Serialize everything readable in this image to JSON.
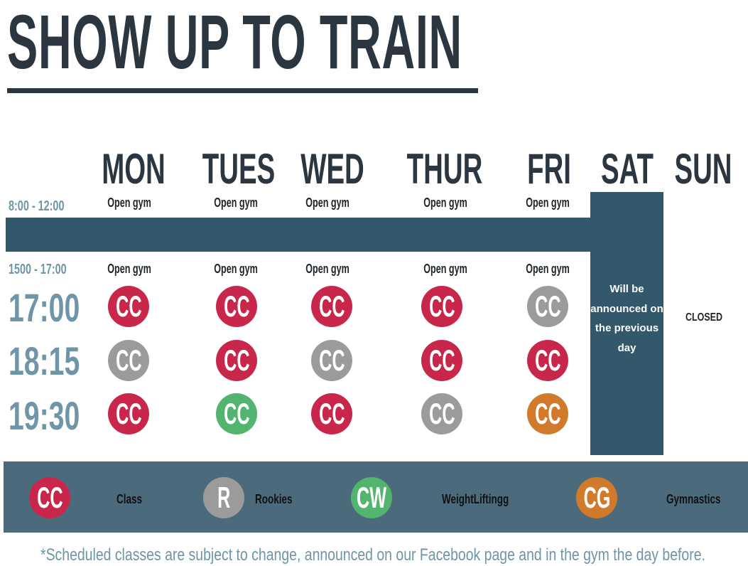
{
  "title": "SHOW UP TO TRAIN",
  "days": [
    "MON",
    "TUES",
    "WED",
    "THUR",
    "FRI",
    "SAT",
    "SUN"
  ],
  "slots": {
    "morning": "8:00 - 12:00",
    "afternoon": "1500 - 17:00",
    "open_gym_label": "Open gym"
  },
  "times": [
    "17:00",
    "18:15",
    "19:30"
  ],
  "schedule": [
    [
      {
        "code": "CC",
        "color": "#c8274b"
      },
      {
        "code": "CC",
        "color": "#c8274b"
      },
      {
        "code": "CC",
        "color": "#c8274b"
      },
      {
        "code": "CC",
        "color": "#c8274b"
      },
      {
        "code": "CC",
        "color": "#9b9b9b"
      }
    ],
    [
      {
        "code": "CC",
        "color": "#9b9b9b"
      },
      {
        "code": "CC",
        "color": "#c8274b"
      },
      {
        "code": "CC",
        "color": "#9b9b9b"
      },
      {
        "code": "CC",
        "color": "#c8274b"
      },
      {
        "code": "CC",
        "color": "#c8274b"
      }
    ],
    [
      {
        "code": "CC",
        "color": "#c8274b"
      },
      {
        "code": "CC",
        "color": "#53b46f"
      },
      {
        "code": "CC",
        "color": "#c8274b"
      },
      {
        "code": "CC",
        "color": "#9b9b9b"
      },
      {
        "code": "CC",
        "color": "#d27a2c"
      }
    ]
  ],
  "saturday_note": "Will be announced on the previous day",
  "sunday_note": "CLOSED",
  "legend": [
    {
      "code": "CC",
      "label": "Class",
      "color": "#c8274b"
    },
    {
      "code": "R",
      "label": "Rookies",
      "color": "#9b9b9b"
    },
    {
      "code": "CW",
      "label": "WeightLiftingg",
      "color": "#53b46f"
    },
    {
      "code": "CG",
      "label": "Gymnastics",
      "color": "#d27a2c"
    }
  ],
  "footer": "*Scheduled classes are subject to change, announced on our Facebook page and in the gym the day before.",
  "colors": {
    "dark_text": "#2b3640",
    "slate_band": "#33586b",
    "legend_band": "#4b6b7d",
    "time_blue": "#6f95a8"
  }
}
